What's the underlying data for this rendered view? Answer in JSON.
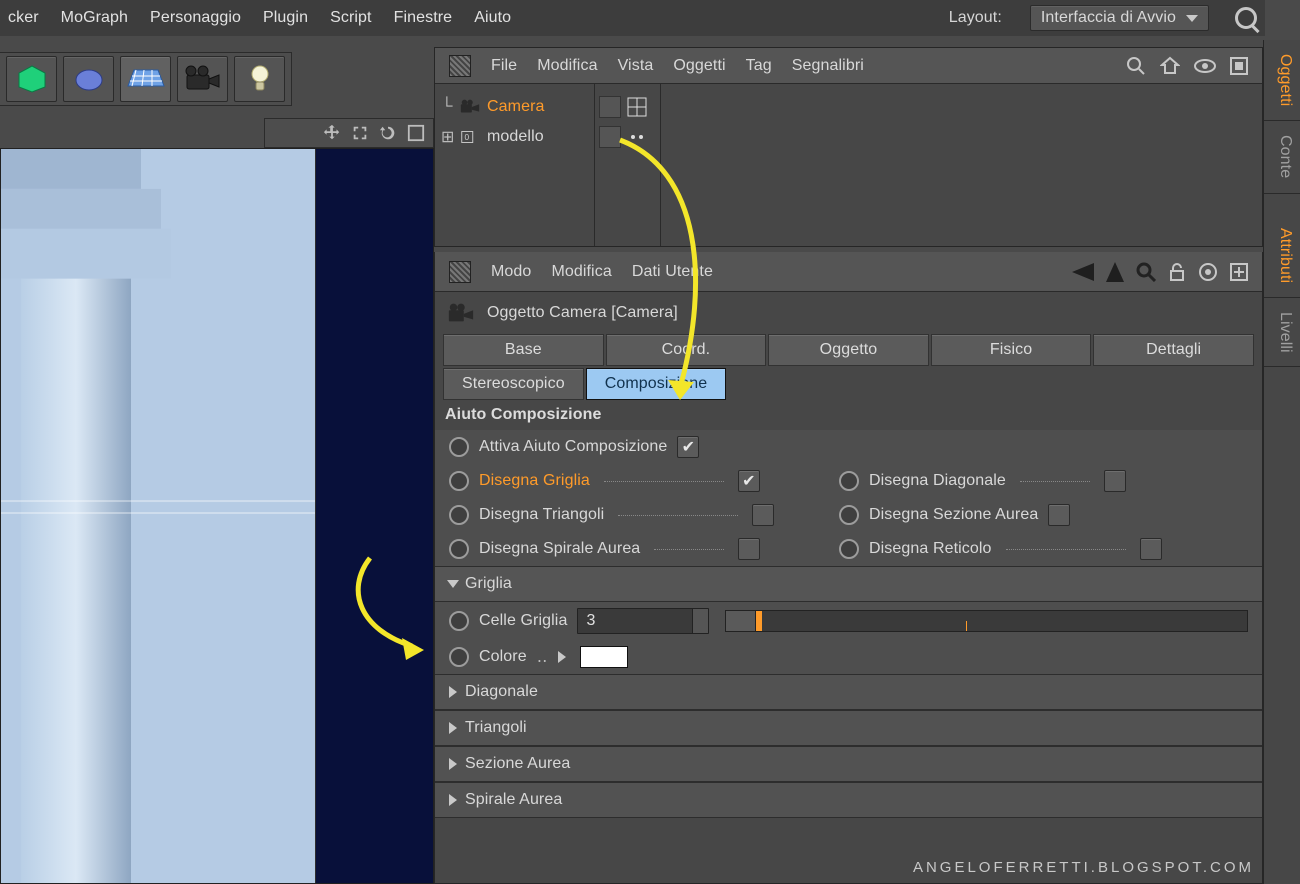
{
  "menu": {
    "items": [
      "cker",
      "MoGraph",
      "Personaggio",
      "Plugin",
      "Script",
      "Finestre",
      "Aiuto"
    ],
    "layout_label": "Layout:",
    "layout_value": "Interfaccia di Avvio"
  },
  "sidetabs": {
    "items": [
      "Oggetti",
      "Conte",
      "Attributi",
      "Livelli"
    ]
  },
  "objects": {
    "menu": [
      "File",
      "Modifica",
      "Vista",
      "Oggetti",
      "Tag",
      "Segnalibri"
    ],
    "rows": [
      {
        "name": "Camera",
        "selected": true
      },
      {
        "name": "modello",
        "selected": false
      }
    ]
  },
  "attrs": {
    "menu": [
      "Modo",
      "Modifica",
      "Dati Utente"
    ],
    "title": "Oggetto Camera [Camera]",
    "tabs": [
      "Base",
      "Coord.",
      "Oggetto",
      "Fisico",
      "Dettagli"
    ],
    "tabs2": [
      "Stereoscopico",
      "Composizione"
    ],
    "active_tab": "Composizione",
    "section_title": "Aiuto Composizione",
    "enable_label": "Attiva Aiuto Composizione",
    "opts": [
      {
        "l": "Disegna Griglia",
        "hi": true,
        "c": true
      },
      {
        "l": "Disegna Triangoli",
        "hi": false,
        "c": false
      },
      {
        "l": "Disegna Spirale Aurea",
        "hi": false,
        "c": false
      }
    ],
    "opts_r": [
      {
        "l": "Disegna Diagonale",
        "c": false
      },
      {
        "l": "Disegna Sezione Aurea",
        "c": false
      },
      {
        "l": "Disegna Reticolo",
        "c": false
      }
    ],
    "grid": {
      "title": "Griglia",
      "cells_label": "Celle Griglia",
      "cells_value": "3",
      "color_label": "Colore"
    },
    "folds": [
      "Diagonale",
      "Triangoli",
      "Sezione Aurea",
      "Spirale Aurea"
    ]
  },
  "watermark": "ANGELOFERRETTI.BLOGSPOT.COM"
}
